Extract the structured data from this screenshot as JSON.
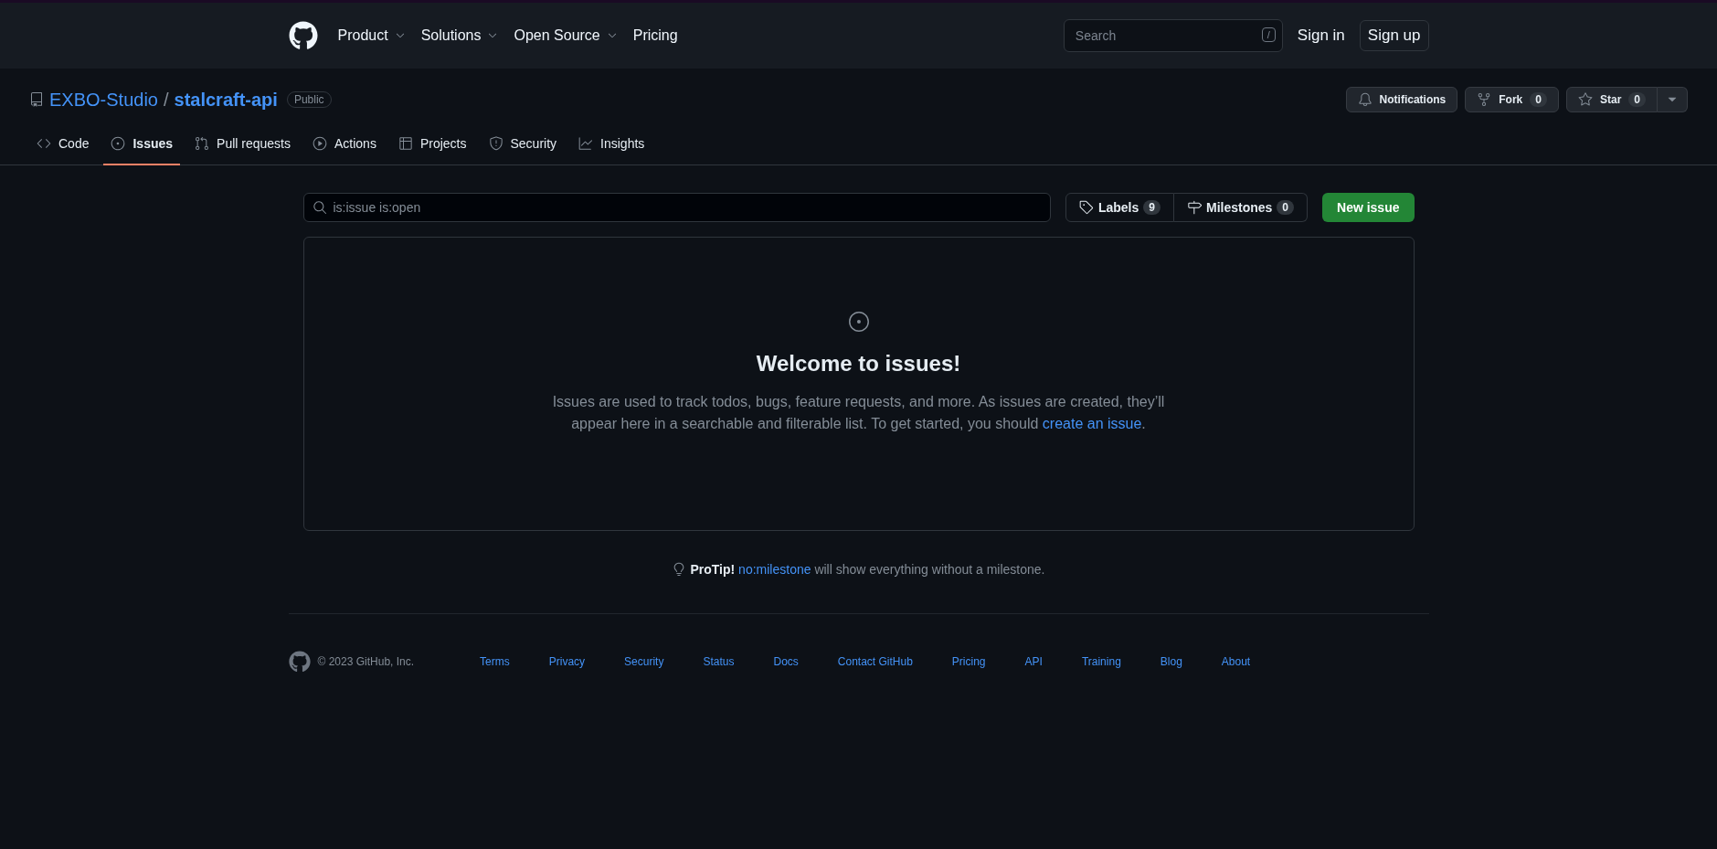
{
  "header": {
    "nav": [
      {
        "label": "Product",
        "has_menu": true
      },
      {
        "label": "Solutions",
        "has_menu": true
      },
      {
        "label": "Open Source",
        "has_menu": true
      },
      {
        "label": "Pricing",
        "has_menu": false
      }
    ],
    "search": {
      "placeholder": "Search",
      "shortcut": "/"
    },
    "sign_in": "Sign in",
    "sign_up": "Sign up"
  },
  "repo": {
    "owner": "EXBO-Studio",
    "separator": "/",
    "name": "stalcraft-api",
    "visibility": "Public",
    "actions": [
      {
        "kind": "notifications",
        "label": "Notifications"
      },
      {
        "kind": "fork",
        "label": "Fork",
        "count": "0"
      },
      {
        "kind": "star",
        "label": "Star",
        "count": "0"
      }
    ]
  },
  "tabs": [
    {
      "label": "Code",
      "selected": false
    },
    {
      "label": "Issues",
      "selected": true
    },
    {
      "label": "Pull requests",
      "selected": false
    },
    {
      "label": "Actions",
      "selected": false
    },
    {
      "label": "Projects",
      "selected": false
    },
    {
      "label": "Security",
      "selected": false
    },
    {
      "label": "Insights",
      "selected": false
    }
  ],
  "toolbar": {
    "filter": "is:issue is:open",
    "labels": {
      "label": "Labels",
      "count": "9"
    },
    "milestones": {
      "label": "Milestones",
      "count": "0"
    },
    "new_issue": "New issue"
  },
  "blankslate": {
    "title": "Welcome to issues!",
    "text": "Issues are used to track todos, bugs, feature requests, and more. As issues are created, they’ll appear here in a searchable and filterable list. To get started, you should ",
    "link": "create an issue",
    "text_after": "."
  },
  "protip": {
    "lead": "ProTip!",
    "link": "no:milestone",
    "text": " will show everything without a milestone."
  },
  "footer": {
    "copyright": "© 2023 GitHub, Inc.",
    "links": [
      "Terms",
      "Privacy",
      "Security",
      "Status",
      "Docs",
      "Contact GitHub",
      "Pricing",
      "API",
      "Training",
      "Blog",
      "About"
    ]
  }
}
